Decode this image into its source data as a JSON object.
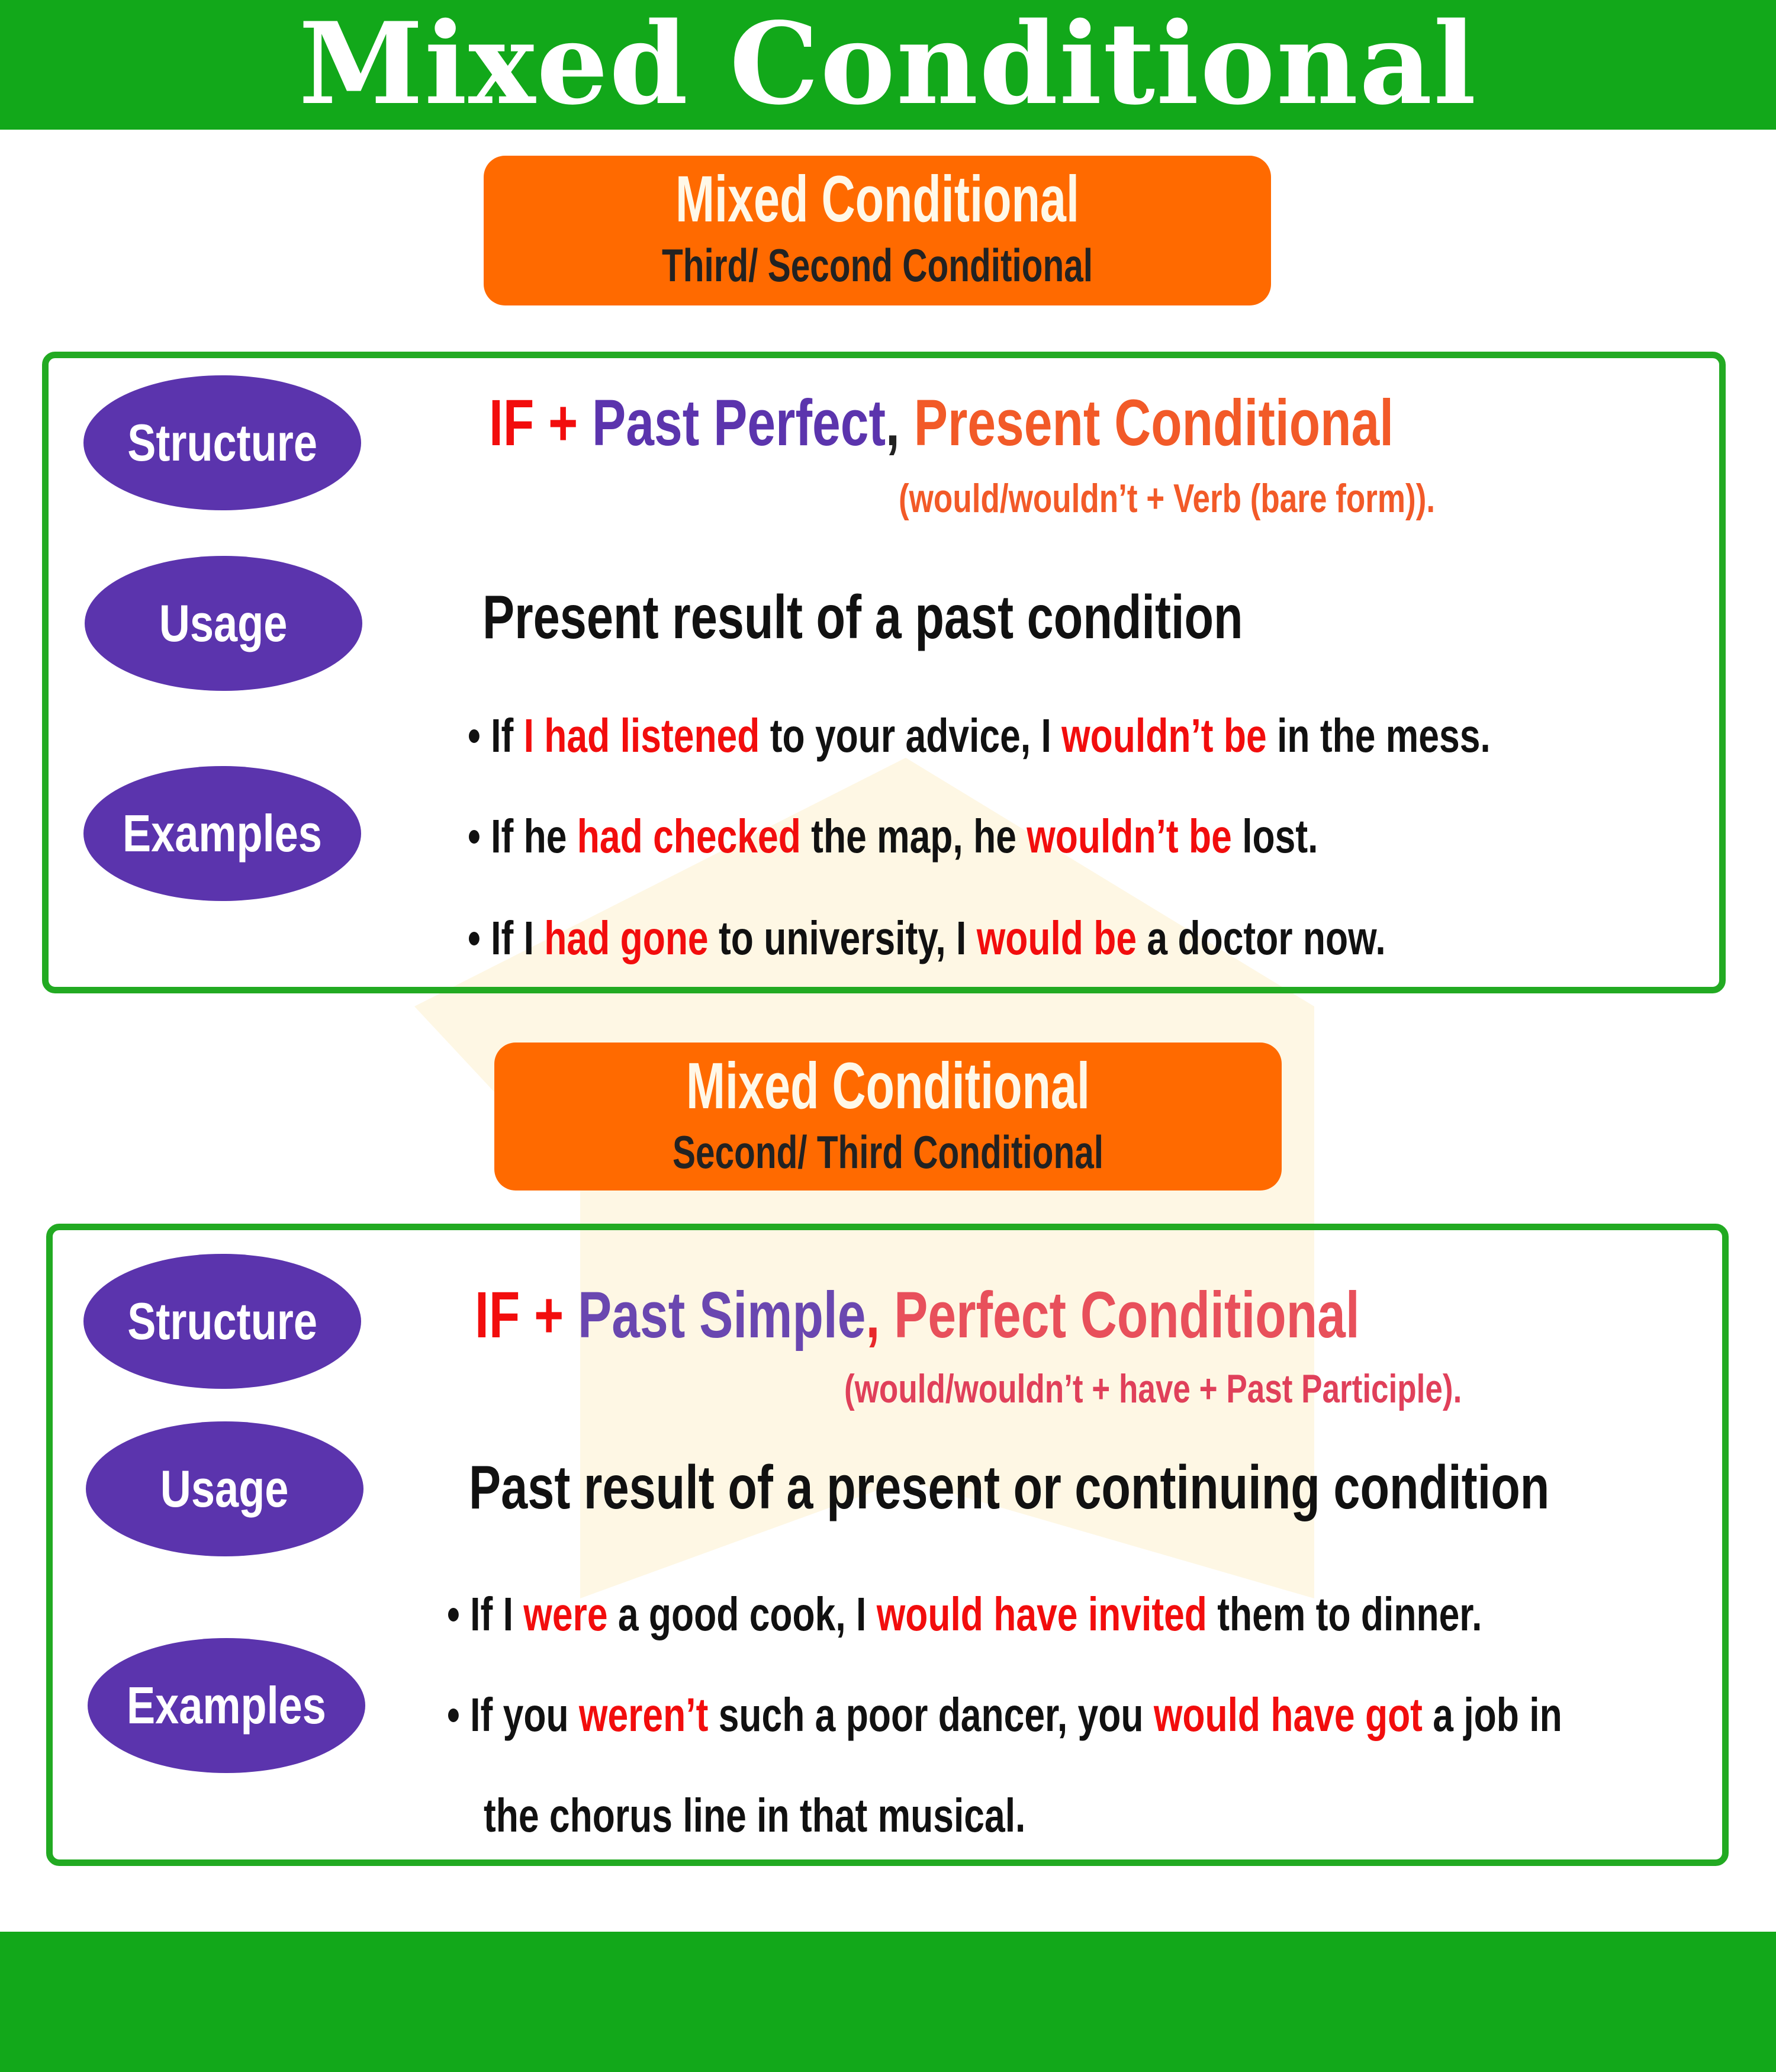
{
  "header": {
    "title": "Mixed Conditional"
  },
  "colors": {
    "green": "#12a81a",
    "orange": "#ff6a00",
    "purple": "#5b34ad",
    "red": "#f20d0d",
    "orange_red": "#f25a28",
    "pink_red": "#e8505b"
  },
  "sections": [
    {
      "badge": {
        "title": "Mixed Conditional",
        "subtitle": "Third/ Second Conditional"
      },
      "labels": {
        "structure": "Structure",
        "usage": "Usage",
        "examples": "Examples"
      },
      "formula": {
        "if": "IF + ",
        "tense": "Past Perfect",
        "comma": ", ",
        "result": "Present Conditional"
      },
      "formula_note": "(would/wouldn’t + Verb (bare form)).",
      "usage_text": "Present result of a past condition",
      "examples": [
        [
          {
            "t": "If ",
            "hl": false
          },
          {
            "t": "I had listened",
            "hl": true
          },
          {
            "t": " to your advice, I ",
            "hl": false
          },
          {
            "t": "wouldn’t be",
            "hl": true
          },
          {
            "t": " in the mess.",
            "hl": false
          }
        ],
        [
          {
            "t": "If he ",
            "hl": false
          },
          {
            "t": "had checked",
            "hl": true
          },
          {
            "t": " the map, he ",
            "hl": false
          },
          {
            "t": "wouldn’t be",
            "hl": true
          },
          {
            "t": " lost.",
            "hl": false
          }
        ],
        [
          {
            "t": "If I ",
            "hl": false
          },
          {
            "t": "had gone",
            "hl": true
          },
          {
            "t": " to university, I ",
            "hl": false
          },
          {
            "t": "would be",
            "hl": true
          },
          {
            "t": " a doctor now.",
            "hl": false
          }
        ]
      ]
    },
    {
      "badge": {
        "title": "Mixed Conditional",
        "subtitle": "Second/ Third Conditional"
      },
      "labels": {
        "structure": "Structure",
        "usage": "Usage",
        "examples": "Examples"
      },
      "formula": {
        "if": "IF + ",
        "tense": "Past Simple",
        "comma": ", ",
        "result": "Perfect Conditional"
      },
      "formula_note": "(would/wouldn’t + have + Past Participle).",
      "usage_text": "Past result of a present or continuing condition",
      "examples": [
        [
          {
            "t": "If I ",
            "hl": false
          },
          {
            "t": "were",
            "hl": true
          },
          {
            "t": " a good cook, I ",
            "hl": false
          },
          {
            "t": "would have invited",
            "hl": true
          },
          {
            "t": " them to dinner.",
            "hl": false
          }
        ],
        [
          {
            "t": "If you ",
            "hl": false
          },
          {
            "t": "weren’t",
            "hl": true
          },
          {
            "t": " such a poor dancer, you ",
            "hl": false
          },
          {
            "t": "would have got",
            "hl": true
          },
          {
            "t": " a job in",
            "hl": false
          }
        ],
        [
          {
            "t": "the chorus line in that musical.",
            "hl": false
          }
        ]
      ]
    }
  ]
}
